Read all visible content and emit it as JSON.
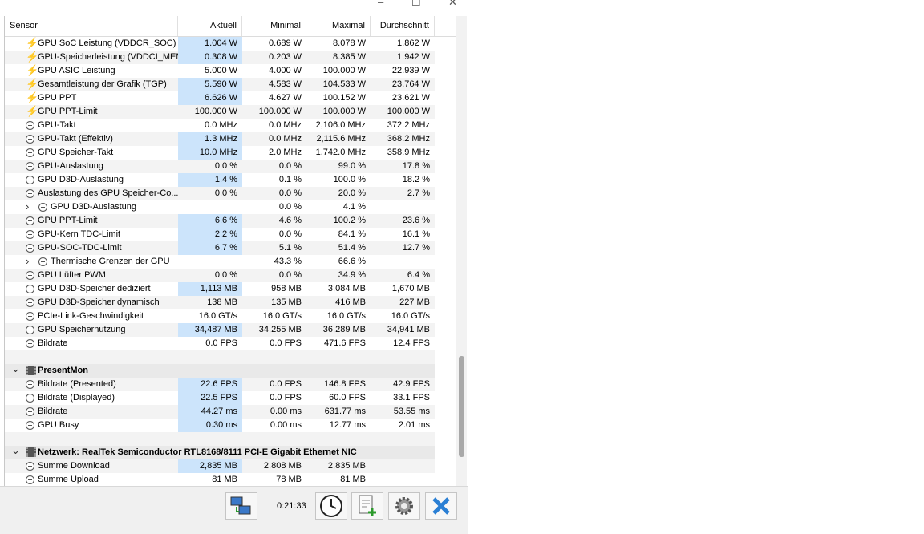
{
  "window_controls": [
    "–",
    "☐",
    "✕"
  ],
  "columns": {
    "sensor": "Sensor",
    "current": "Aktuell",
    "min": "Minimal",
    "max": "Maximal",
    "avg": "Durchschnitt"
  },
  "rows": [
    {
      "type": "sensor",
      "icon": "bolt-icon",
      "indent": 1,
      "name": "GPU SoC Leistung (VDDCR_SOC)",
      "cur": "1.004 W",
      "min": "0.689 W",
      "max": "8.078 W",
      "avg": "1.862 W",
      "hl": true
    },
    {
      "type": "sensor",
      "icon": "bolt-icon",
      "indent": 1,
      "name": "GPU-Speicherleistung (VDDCI_MEM)",
      "cur": "0.308 W",
      "min": "0.203 W",
      "max": "8.385 W",
      "avg": "1.942 W",
      "hl": true
    },
    {
      "type": "sensor",
      "icon": "bolt-icon",
      "indent": 1,
      "name": "GPU ASIC Leistung",
      "cur": "5.000 W",
      "min": "4.000 W",
      "max": "100.000 W",
      "avg": "22.939 W",
      "hl": false
    },
    {
      "type": "sensor",
      "icon": "bolt-icon",
      "indent": 1,
      "name": "Gesamtleistung der Grafik (TGP)",
      "cur": "5.590 W",
      "min": "4.583 W",
      "max": "104.533 W",
      "avg": "23.764 W",
      "hl": true
    },
    {
      "type": "sensor",
      "icon": "bolt-icon",
      "indent": 1,
      "name": "GPU PPT",
      "cur": "6.626 W",
      "min": "4.627 W",
      "max": "100.152 W",
      "avg": "23.621 W",
      "hl": true
    },
    {
      "type": "sensor",
      "icon": "bolt-icon",
      "indent": 1,
      "name": "GPU PPT-Limit",
      "cur": "100.000 W",
      "min": "100.000 W",
      "max": "100.000 W",
      "avg": "100.000 W",
      "hl": false
    },
    {
      "type": "sensor",
      "icon": "clock-icon",
      "indent": 1,
      "name": "GPU-Takt",
      "cur": "0.0 MHz",
      "min": "0.0 MHz",
      "max": "2,106.0 MHz",
      "avg": "372.2 MHz",
      "hl": false
    },
    {
      "type": "sensor",
      "icon": "clock-icon",
      "indent": 1,
      "name": "GPU-Takt (Effektiv)",
      "cur": "1.3 MHz",
      "min": "0.0 MHz",
      "max": "2,115.6 MHz",
      "avg": "368.2 MHz",
      "hl": true
    },
    {
      "type": "sensor",
      "icon": "clock-icon",
      "indent": 1,
      "name": "GPU Speicher-Takt",
      "cur": "10.0 MHz",
      "min": "2.0 MHz",
      "max": "1,742.0 MHz",
      "avg": "358.9 MHz",
      "hl": true
    },
    {
      "type": "sensor",
      "icon": "clock-icon",
      "indent": 1,
      "name": "GPU-Auslastung",
      "cur": "0.0 %",
      "min": "0.0 %",
      "max": "99.0 %",
      "avg": "17.8 %",
      "hl": false
    },
    {
      "type": "sensor",
      "icon": "clock-icon",
      "indent": 1,
      "name": "GPU D3D-Auslastung",
      "cur": "1.4 %",
      "min": "0.1 %",
      "max": "100.0 %",
      "avg": "18.2 %",
      "hl": true
    },
    {
      "type": "sensor",
      "icon": "clock-icon",
      "indent": 1,
      "name": "Auslastung des GPU Speicher-Co...",
      "cur": "0.0 %",
      "min": "0.0 %",
      "max": "20.0 %",
      "avg": "2.7 %",
      "hl": false
    },
    {
      "type": "sensor",
      "icon": "clock-icon",
      "indent": 2,
      "expand": "›",
      "name": "GPU D3D-Auslastung",
      "cur": "",
      "min": "0.0 %",
      "max": "4.1 %",
      "avg": "",
      "hl": false
    },
    {
      "type": "sensor",
      "icon": "clock-icon",
      "indent": 1,
      "name": "GPU PPT-Limit",
      "cur": "6.6 %",
      "min": "4.6 %",
      "max": "100.2 %",
      "avg": "23.6 %",
      "hl": true
    },
    {
      "type": "sensor",
      "icon": "clock-icon",
      "indent": 1,
      "name": "GPU-Kern TDC-Limit",
      "cur": "2.2 %",
      "min": "0.0 %",
      "max": "84.1 %",
      "avg": "16.1 %",
      "hl": true
    },
    {
      "type": "sensor",
      "icon": "clock-icon",
      "indent": 1,
      "name": "GPU-SOC-TDC-Limit",
      "cur": "6.7 %",
      "min": "5.1 %",
      "max": "51.4 %",
      "avg": "12.7 %",
      "hl": true
    },
    {
      "type": "sensor",
      "icon": "clock-icon",
      "indent": 2,
      "expand": "›",
      "name": "Thermische Grenzen der GPU",
      "cur": "",
      "min": "43.3 %",
      "max": "66.6 %",
      "avg": "",
      "hl": false
    },
    {
      "type": "sensor",
      "icon": "clock-icon",
      "indent": 1,
      "name": "GPU Lüfter PWM",
      "cur": "0.0 %",
      "min": "0.0 %",
      "max": "34.9 %",
      "avg": "6.4 %",
      "hl": false
    },
    {
      "type": "sensor",
      "icon": "clock-icon",
      "indent": 1,
      "name": "GPU D3D-Speicher dediziert",
      "cur": "1,113 MB",
      "min": "958 MB",
      "max": "3,084 MB",
      "avg": "1,670 MB",
      "hl": true
    },
    {
      "type": "sensor",
      "icon": "clock-icon",
      "indent": 1,
      "name": "GPU D3D-Speicher dynamisch",
      "cur": "138 MB",
      "min": "135 MB",
      "max": "416 MB",
      "avg": "227 MB",
      "hl": false
    },
    {
      "type": "sensor",
      "icon": "clock-icon",
      "indent": 1,
      "name": "PCIe-Link-Geschwindigkeit",
      "cur": "16.0 GT/s",
      "min": "16.0 GT/s",
      "max": "16.0 GT/s",
      "avg": "16.0 GT/s",
      "hl": false
    },
    {
      "type": "sensor",
      "icon": "clock-icon",
      "indent": 1,
      "name": "GPU Speichernutzung",
      "cur": "34,487 MB",
      "min": "34,255 MB",
      "max": "36,289 MB",
      "avg": "34,941 MB",
      "hl": true
    },
    {
      "type": "sensor",
      "icon": "clock-icon",
      "indent": 1,
      "name": "Bildrate",
      "cur": "0.0 FPS",
      "min": "0.0 FPS",
      "max": "471.6 FPS",
      "avg": "12.4 FPS",
      "hl": false
    },
    {
      "type": "blank"
    },
    {
      "type": "group",
      "expand": "⌄",
      "name": "PresentMon"
    },
    {
      "type": "sensor",
      "icon": "clock-icon",
      "indent": 1,
      "name": "Bildrate (Presented)",
      "cur": "22.6 FPS",
      "min": "0.0 FPS",
      "max": "146.8 FPS",
      "avg": "42.9 FPS",
      "hl": true
    },
    {
      "type": "sensor",
      "icon": "clock-icon",
      "indent": 1,
      "name": "Bildrate (Displayed)",
      "cur": "22.5 FPS",
      "min": "0.0 FPS",
      "max": "60.0 FPS",
      "avg": "33.1 FPS",
      "hl": true
    },
    {
      "type": "sensor",
      "icon": "clock-icon",
      "indent": 1,
      "name": "Bildrate",
      "cur": "44.27 ms",
      "min": "0.00 ms",
      "max": "631.77 ms",
      "avg": "53.55 ms",
      "hl": true
    },
    {
      "type": "sensor",
      "icon": "clock-icon",
      "indent": 1,
      "name": "GPU Busy",
      "cur": "0.30 ms",
      "min": "0.00 ms",
      "max": "12.77 ms",
      "avg": "2.01 ms",
      "hl": true
    },
    {
      "type": "blank"
    },
    {
      "type": "group",
      "expand": "⌄",
      "name": "Netzwerk: RealTek Semiconductor RTL8168/8111 PCI-E Gigabit Ethernet NIC"
    },
    {
      "type": "sensor",
      "icon": "clock-icon",
      "indent": 1,
      "name": "Summe Download",
      "cur": "2,835 MB",
      "min": "2,808 MB",
      "max": "2,835 MB",
      "avg": "",
      "hl": true
    },
    {
      "type": "sensor",
      "icon": "clock-icon",
      "indent": 1,
      "name": "Summe Upload",
      "cur": "81 MB",
      "min": "78 MB",
      "max": "81 MB",
      "avg": "",
      "hl": false
    }
  ],
  "toolbar": {
    "elapsed": "0:21:33",
    "buttons": [
      "network-icon",
      "clock-icon",
      "report-add-icon",
      "gear-icon",
      "close-icon"
    ]
  },
  "colors": {
    "highlight": "#cce4fb",
    "alt_row": "#f3f3f3",
    "group_bg": "#e9e9e9",
    "bolt": "#e8b800",
    "close": "#2a7fd4"
  }
}
